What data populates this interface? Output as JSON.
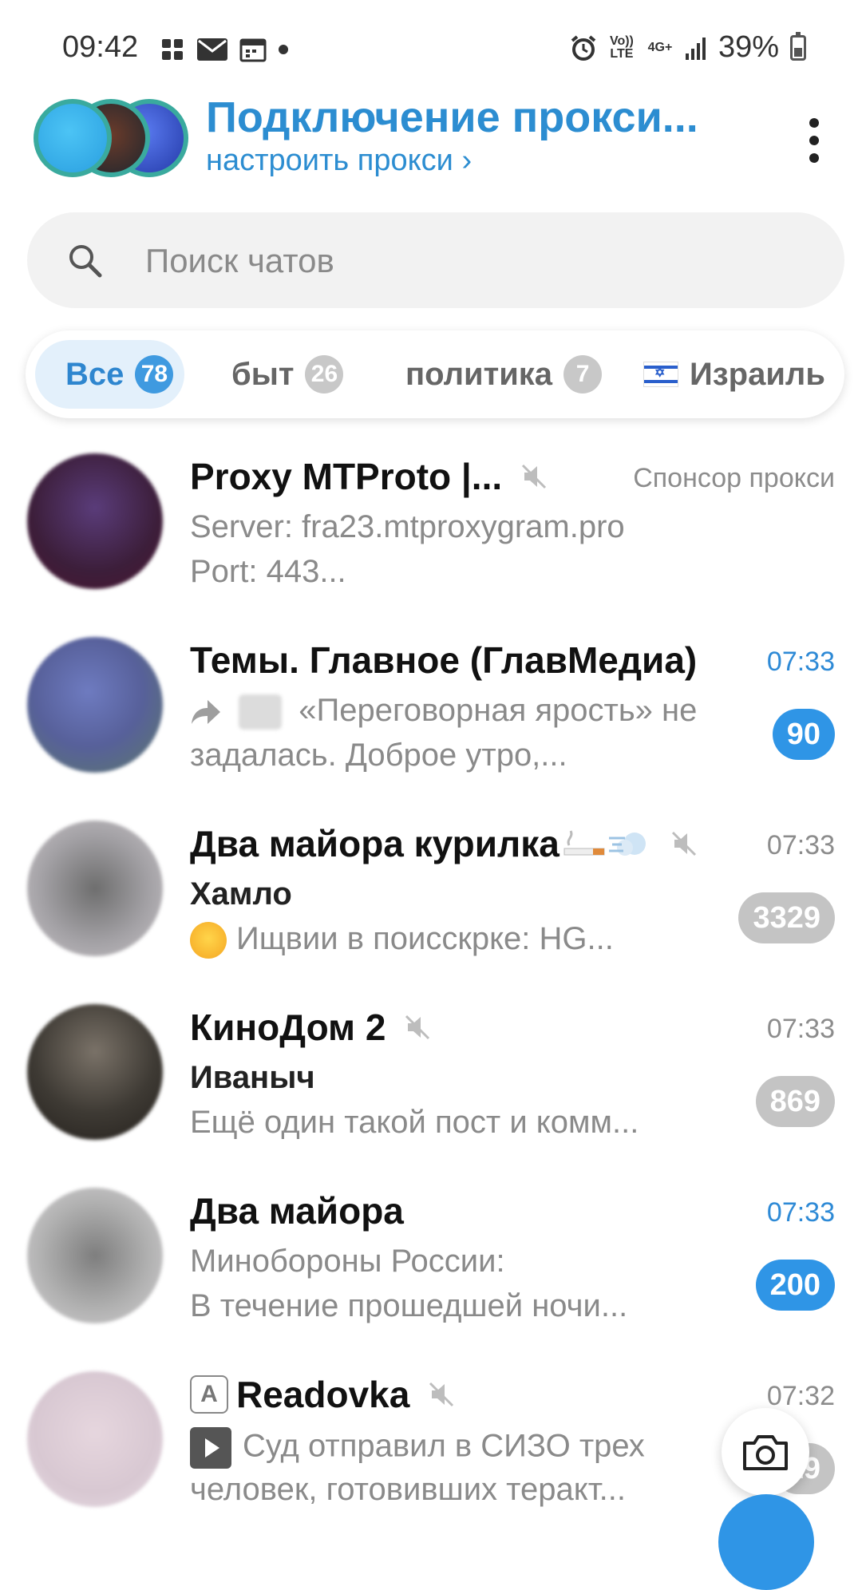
{
  "status_bar": {
    "time": "09:42",
    "battery": "39%",
    "network": "4G+",
    "volte": "Vo)) LTE",
    "left_icons": [
      "puzzle-icon",
      "mail-icon",
      "calendar-icon",
      "dot-icon"
    ],
    "right_icons": [
      "alarm-icon",
      "volte-icon",
      "4g-icon",
      "signal-icon",
      "battery-icon"
    ]
  },
  "header": {
    "title": "Подключение прокси...",
    "subtitle": "настроить прокси ›",
    "menu_icon": "more-vertical-icon"
  },
  "search": {
    "placeholder": "Поиск чатов",
    "icon": "search-icon"
  },
  "tabs": [
    {
      "label": "Все",
      "count": "78",
      "active": true
    },
    {
      "label": "быт",
      "count": "26",
      "active": false
    },
    {
      "label": "политика",
      "count": "7",
      "active": false
    },
    {
      "label": "Израиль",
      "count": "",
      "active": false,
      "flag": "israel-flag-icon"
    }
  ],
  "chats": [
    {
      "title": "Proxy MTProto |...",
      "muted": true,
      "time": "Спонсор прокси",
      "line2": "Server: fra23.mtproxygram.pro",
      "line3": "Port: 443...",
      "count": ""
    },
    {
      "title": "Темы. Главное (ГлавМедиа)",
      "muted": false,
      "time": "07:33",
      "line2": "«Переговорная ярость» не",
      "line3": "задалась.  Доброе утро,...",
      "count": "90"
    },
    {
      "title": "Два майора курилка",
      "muted": true,
      "time": "07:33",
      "sender": "Хамло",
      "line3": "Ищвии в поисскрке: HG...",
      "count": "3329"
    },
    {
      "title": "КиноДом 2",
      "muted": true,
      "time": "07:33",
      "sender": "Иваныч",
      "line3": "Ещё один такой пост и комм...",
      "count": "869"
    },
    {
      "title": "Два майора",
      "muted": false,
      "time": "07:33",
      "line2": "Минобороны России:",
      "line3": " В течение прошедшей ночи...",
      "count": "200"
    },
    {
      "title": "Readovka",
      "muted": true,
      "time": "07:32",
      "line2": "Суд отправил в СИЗО трех",
      "line3": "человек, готовивших теракт...",
      "count": "19"
    }
  ],
  "colors": {
    "accent": "#2e86cf",
    "badge": "#2f95e6",
    "muted_badge": "#c4c4c4"
  }
}
